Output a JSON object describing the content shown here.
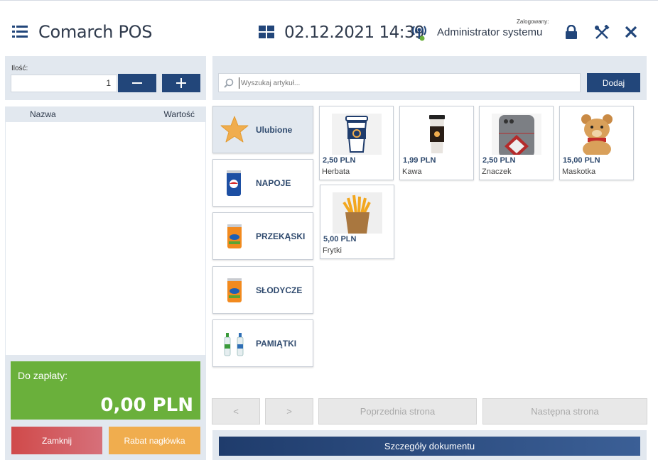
{
  "header": {
    "app_title": "Comarch POS",
    "datetime": "02.12.2021 14:39",
    "logged_label": "Zalogowany:",
    "user": "Administrator systemu"
  },
  "quantity": {
    "label": "Ilość:",
    "value": "1"
  },
  "list": {
    "col_name": "Nazwa",
    "col_value": "Wartość"
  },
  "payment": {
    "label": "Do zapłaty:",
    "amount": "0,00 PLN",
    "close_label": "Zamknij",
    "discount_label": "Rabat nagłówka"
  },
  "search": {
    "placeholder": "Wyszukaj artykuł...",
    "add_label": "Dodaj"
  },
  "categories": [
    {
      "label": "Ulubione",
      "icon": "star-icon"
    },
    {
      "label": "NAPOJE",
      "icon": "soda-can-icon"
    },
    {
      "label": "PRZEKĄSKI",
      "icon": "orange-can-icon"
    },
    {
      "label": "SŁODYCZE",
      "icon": "orange-can-icon"
    },
    {
      "label": "PAMIĄTKI",
      "icon": "water-bottles-icon"
    }
  ],
  "products": [
    {
      "price": "2,50 PLN",
      "name": "Herbata",
      "icon": "cup-icon"
    },
    {
      "price": "1,99 PLN",
      "name": "Kawa",
      "icon": "coffee-icon"
    },
    {
      "price": "2,50 PLN",
      "name": "Znaczek",
      "icon": "phone-case-icon"
    },
    {
      "price": "15,00 PLN",
      "name": "Maskotka",
      "icon": "teddy-bear-icon"
    },
    {
      "price": "5,00 PLN",
      "name": "Frytki",
      "icon": "fries-icon"
    }
  ],
  "pager": {
    "prev_small": "<",
    "next_small": ">",
    "prev_page": "Poprzednia strona",
    "next_page": "Następna strona"
  },
  "details_label": "Szczegóły dokumentu",
  "colors": {
    "primary": "#22467a",
    "pay_green": "#6ab03b",
    "close_red": "#d04a4a",
    "discount_orange": "#f0ad4e",
    "panel_bg": "#e2e8ef"
  }
}
